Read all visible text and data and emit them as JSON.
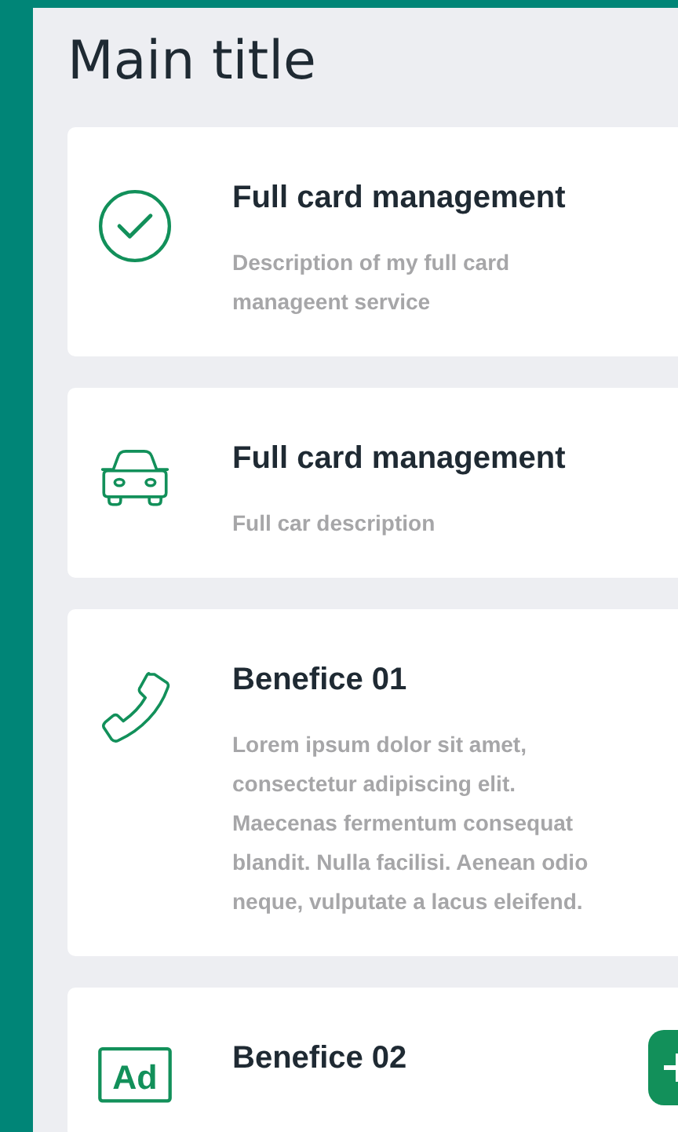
{
  "title": "Main title",
  "cards": [
    {
      "kind": "check",
      "title": "Full card management",
      "description": "Description of my full card manageent service"
    },
    {
      "kind": "car",
      "title": "Full card management",
      "description": "Full car description"
    },
    {
      "kind": "phone",
      "title": "Benefice 01",
      "description": "Lorem ipsum dolor sit amet, consectetur adipiscing elit. Maecenas fermentum consequat blandit. Nulla facilisi. Aenean odio neque, vulputate a lacus eleifend."
    },
    {
      "kind": "ad",
      "icon_text": "Ad",
      "title": "Benefice 02"
    }
  ]
}
